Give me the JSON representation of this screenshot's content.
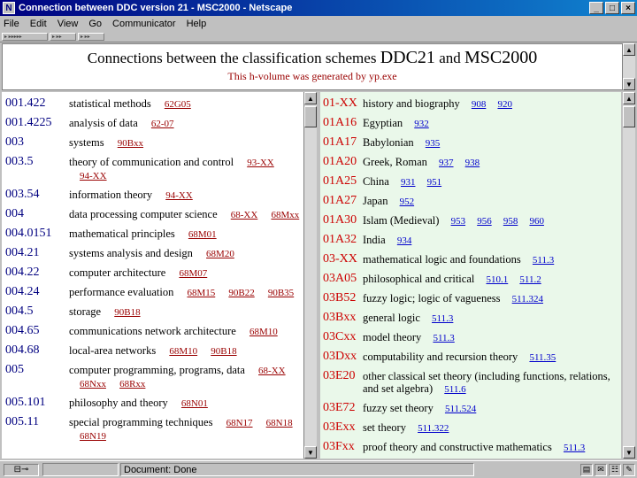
{
  "window": {
    "title": "Connection between DDC version 21 - MSC2000 - Netscape"
  },
  "menu": [
    "File",
    "Edit",
    "View",
    "Go",
    "Communicator",
    "Help"
  ],
  "toolbar": {
    "grips": [
      "Navigation",
      "Location",
      "Personal"
    ]
  },
  "header": {
    "title_prefix": "Connections between the classification schemes",
    "scheme_a": "DDC21",
    "conj": "and",
    "scheme_b": "MSC2000",
    "subtitle": "This h-volume was generated by yp.exe"
  },
  "ddc_rows": [
    {
      "code": "001.422",
      "label": "statistical methods",
      "links": [
        "62G05"
      ]
    },
    {
      "code": "001.4225",
      "label": "analysis of data",
      "links": [
        "62-07"
      ]
    },
    {
      "code": "003",
      "label": "systems",
      "links": [
        "90Bxx"
      ]
    },
    {
      "code": "003.5",
      "label": "theory of communication and control",
      "links": [
        "93-XX",
        "94-XX"
      ]
    },
    {
      "code": "003.54",
      "label": "information theory",
      "links": [
        "94-XX"
      ]
    },
    {
      "code": "004",
      "label": "data processing    computer science",
      "links": [
        "68-XX",
        "68Mxx"
      ]
    },
    {
      "code": "004.0151",
      "label": "mathematical principles",
      "links": [
        "68M01"
      ]
    },
    {
      "code": "004.21",
      "label": "systems analysis and design",
      "links": [
        "68M20"
      ]
    },
    {
      "code": "004.22",
      "label": "computer architecture",
      "links": [
        "68M07"
      ]
    },
    {
      "code": "004.24",
      "label": "performance evaluation",
      "links": [
        "68M15",
        "90B22",
        "90B35"
      ]
    },
    {
      "code": "004.5",
      "label": "storage",
      "links": [
        "90B18"
      ]
    },
    {
      "code": "004.65",
      "label": "communications network architecture",
      "links": [
        "68M10"
      ]
    },
    {
      "code": "004.68",
      "label": "local-area networks",
      "links": [
        "68M10",
        "90B18"
      ]
    },
    {
      "code": "005",
      "label": "computer programming, programs, data",
      "links": [
        "68-XX",
        "68Nxx",
        "68Rxx"
      ]
    },
    {
      "code": "005.101",
      "label": "philosophy and theory",
      "links": [
        "68N01"
      ]
    },
    {
      "code": "005.11",
      "label": "special programming techniques",
      "links": [
        "68N17",
        "68N18",
        "68N19"
      ]
    }
  ],
  "msc_rows": [
    {
      "code": "01-XX",
      "label": "history and biography",
      "links": [
        "908",
        "920"
      ]
    },
    {
      "code": "01A16",
      "label": "Egyptian",
      "links": [
        "932"
      ]
    },
    {
      "code": "01A17",
      "label": "Babylonian",
      "links": [
        "935"
      ]
    },
    {
      "code": "01A20",
      "label": "Greek, Roman",
      "links": [
        "937",
        "938"
      ]
    },
    {
      "code": "01A25",
      "label": "China",
      "links": [
        "931",
        "951"
      ]
    },
    {
      "code": "01A27",
      "label": "Japan",
      "links": [
        "952"
      ]
    },
    {
      "code": "01A30",
      "label": "Islam (Medieval)",
      "links": [
        "953",
        "956",
        "958",
        "960"
      ]
    },
    {
      "code": "01A32",
      "label": "India",
      "links": [
        "934"
      ]
    },
    {
      "code": "03-XX",
      "label": "mathematical logic and foundations",
      "links": [
        "511.3"
      ]
    },
    {
      "code": "03A05",
      "label": "philosophical and critical",
      "links": [
        "510.1",
        "511.2"
      ]
    },
    {
      "code": "03B52",
      "label": "fuzzy logic; logic of vagueness",
      "links": [
        "511.324"
      ]
    },
    {
      "code": "03Bxx",
      "label": "general logic",
      "links": [
        "511.3"
      ]
    },
    {
      "code": "03Cxx",
      "label": "model theory",
      "links": [
        "511.3"
      ]
    },
    {
      "code": "03Dxx",
      "label": "computability and recursion theory",
      "links": [
        "511.35"
      ]
    },
    {
      "code": "03E20",
      "label": "other classical set theory (including functions, relations, and set algebra)",
      "links": [
        "511.6"
      ]
    },
    {
      "code": "03E72",
      "label": "fuzzy set theory",
      "links": [
        "511.524"
      ]
    },
    {
      "code": "03Exx",
      "label": "set theory",
      "links": [
        "511.322"
      ]
    },
    {
      "code": "03Fxx",
      "label": "proof theory and constructive mathematics",
      "links": [
        "511.3"
      ]
    }
  ],
  "status": {
    "text": "Document: Done"
  },
  "colors": {
    "title_bar": "#000080",
    "ddc_link": "#990000",
    "msc_code": "#cc0000",
    "msc_link": "#0000cc",
    "msc_bg": "#eaf8ea"
  }
}
